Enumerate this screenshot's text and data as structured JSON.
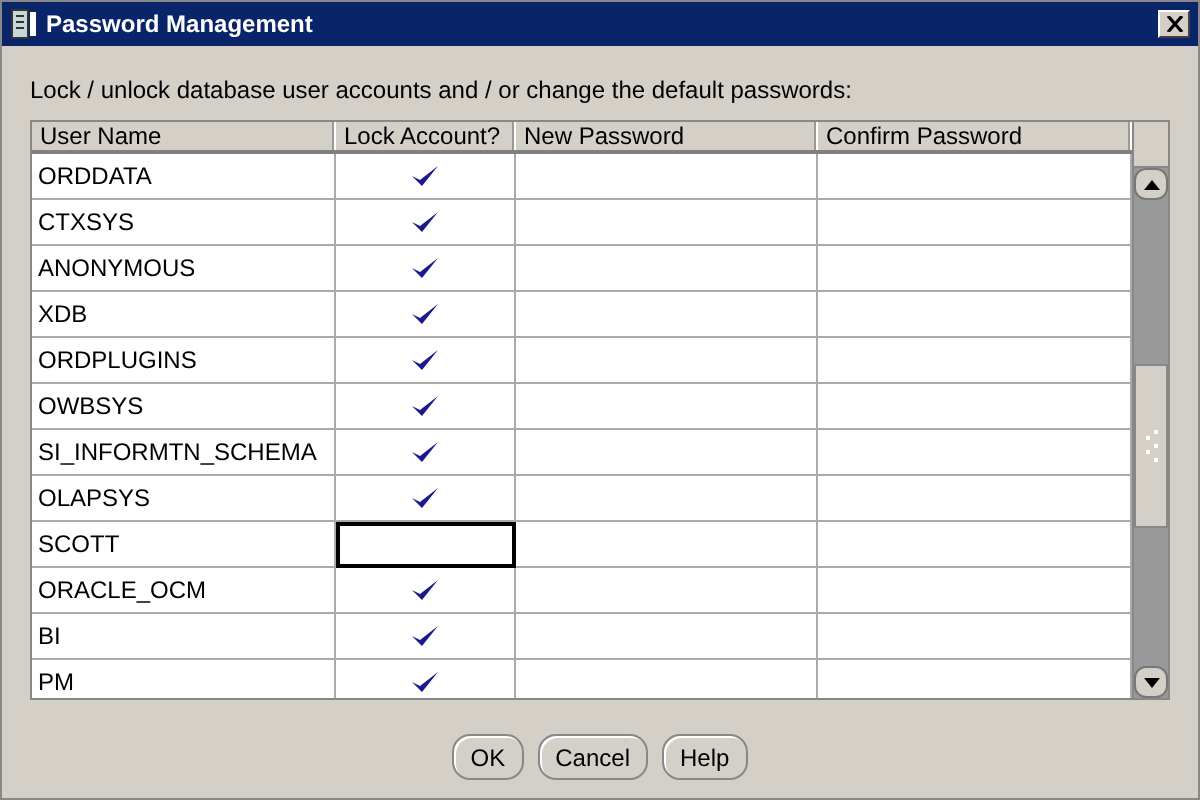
{
  "window": {
    "title": "Password Management"
  },
  "instruction": "Lock / unlock database user accounts and / or change the default passwords:",
  "table": {
    "columns": [
      "User Name",
      "Lock Account?",
      "New Password",
      "Confirm Password"
    ],
    "rows": [
      {
        "user": "ORDDATA",
        "locked": true,
        "focused": false
      },
      {
        "user": "CTXSYS",
        "locked": true,
        "focused": false
      },
      {
        "user": "ANONYMOUS",
        "locked": true,
        "focused": false
      },
      {
        "user": "XDB",
        "locked": true,
        "focused": false
      },
      {
        "user": "ORDPLUGINS",
        "locked": true,
        "focused": false
      },
      {
        "user": "OWBSYS",
        "locked": true,
        "focused": false
      },
      {
        "user": "SI_INFORMTN_SCHEMA",
        "locked": true,
        "focused": false
      },
      {
        "user": "OLAPSYS",
        "locked": true,
        "focused": false
      },
      {
        "user": "SCOTT",
        "locked": false,
        "focused": true
      },
      {
        "user": "ORACLE_OCM",
        "locked": true,
        "focused": false
      },
      {
        "user": "BI",
        "locked": true,
        "focused": false
      },
      {
        "user": "PM",
        "locked": true,
        "focused": false
      }
    ]
  },
  "buttons": [
    "OK",
    "Cancel",
    "Help"
  ]
}
